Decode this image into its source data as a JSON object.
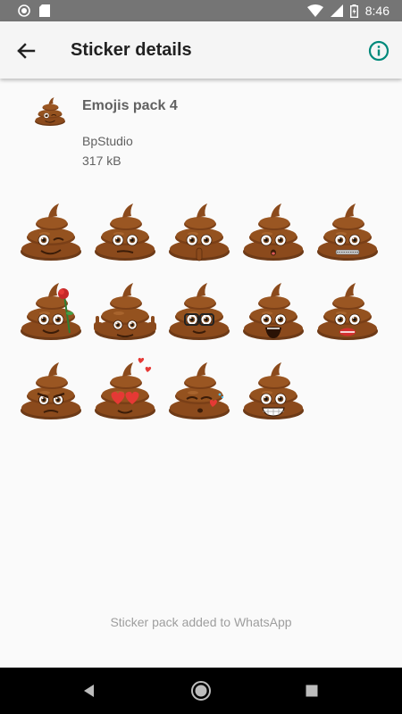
{
  "status_bar": {
    "time": "8:46",
    "icons": [
      "circle-icon",
      "sd-card-icon",
      "wifi-icon",
      "signal-icon",
      "battery-charging-icon"
    ]
  },
  "app_bar": {
    "title": "Sticker details",
    "back_icon": "arrow-back-icon",
    "info_icon": "info-icon",
    "accent_color": "#00897b"
  },
  "pack": {
    "name": "Emojis pack 4",
    "publisher": "BpStudio",
    "size": "317 kB",
    "tray_icon": "poop-emoji-tray-icon"
  },
  "stickers": [
    {
      "name": "sticker-wink",
      "face": "wink"
    },
    {
      "name": "sticker-neutral",
      "face": "neutral"
    },
    {
      "name": "sticker-shush",
      "face": "shush"
    },
    {
      "name": "sticker-surprised",
      "face": "surprised"
    },
    {
      "name": "sticker-zipper",
      "face": "zipper"
    },
    {
      "name": "sticker-rose",
      "face": "rose"
    },
    {
      "name": "sticker-thumbs",
      "face": "thumbs"
    },
    {
      "name": "sticker-glasses",
      "face": "glasses"
    },
    {
      "name": "sticker-scream",
      "face": "scream"
    },
    {
      "name": "sticker-lips",
      "face": "lips"
    },
    {
      "name": "sticker-angry",
      "face": "angry"
    },
    {
      "name": "sticker-heart-eyes",
      "face": "hearts"
    },
    {
      "name": "sticker-kiss",
      "face": "kiss"
    },
    {
      "name": "sticker-grin",
      "face": "grin"
    }
  ],
  "footer": {
    "message": "Sticker pack added to WhatsApp"
  },
  "nav_bar": {
    "icons": [
      "back-triangle-icon",
      "home-circle-icon",
      "recents-square-icon"
    ]
  }
}
